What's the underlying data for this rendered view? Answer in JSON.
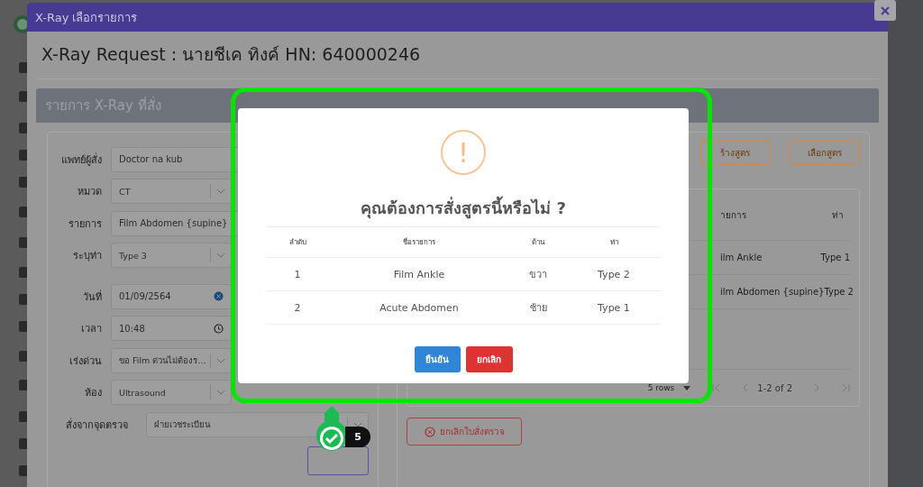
{
  "modal": {
    "title": "X-Ray เลือกรายการ",
    "heading": "X-Ray Request : นายชีเค ทิงค์ HN: 640000246",
    "panel_title": "รายการ X-Ray ที่สั่ง",
    "fields": [
      {
        "label": "แพทย์ผู้สั่ง",
        "value": "Doctor na kub",
        "kind": "text"
      },
      {
        "label": "หมวด",
        "value": "CT",
        "kind": "select"
      },
      {
        "label": "รายการ",
        "value": "Film Abdomen {supine}",
        "kind": "text"
      },
      {
        "label": "ระบุท่า",
        "value": "Type 3",
        "kind": "select"
      },
      {
        "label": "วันที่",
        "value": "01/09/2564",
        "kind": "date"
      },
      {
        "label": "เวลา",
        "value": "10:48",
        "kind": "time"
      },
      {
        "label": "เร่งด่วน",
        "value": "ขอ Film ด่วนไม่ต้องร…",
        "kind": "select"
      },
      {
        "label": "ห้อง",
        "value": "Ultrasound",
        "kind": "select"
      }
    ],
    "source_point": {
      "label": "สั่งจากจุดตรวจ",
      "value": "ฝ่ายเวชระเบียน"
    },
    "formula_buttons": [
      "ร้างสูตร",
      "เลือกสูตร"
    ],
    "orders_table": {
      "columns": [
        "ายการ",
        "ท่า"
      ],
      "rows": [
        [
          "ilm Ankle",
          "Type 1"
        ],
        [
          "ilm Abdomen {supine}",
          "Type 2"
        ]
      ]
    },
    "pagination": {
      "rows_per_page": "5 rows",
      "range": "1-2 of 2"
    },
    "cancel_order_button": "ยกเลิกใบสั่งตรวจ"
  },
  "dialog": {
    "icon": "!",
    "title": "คุณต้องการสั่งสูตรนี้หรือไม่ ?",
    "columns": [
      "ลำดับ",
      "ชื่อรายการ",
      "ด้าน",
      "ท่า"
    ],
    "rows": [
      [
        "1",
        "Film Ankle",
        "ขวา",
        "Type 2"
      ],
      [
        "2",
        "Acute Abdomen",
        "ซ้าย",
        "Type 1"
      ]
    ],
    "confirm_button": "ยืนยัน",
    "cancel_button": "ยกเลิก"
  },
  "annotation": {
    "step": "5"
  }
}
